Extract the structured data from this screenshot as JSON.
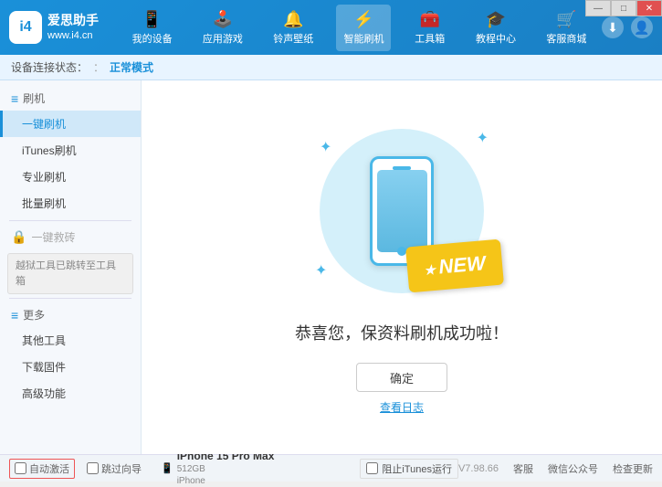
{
  "app": {
    "logo_code": "i4",
    "logo_url": "www.i4.cn",
    "brand_name": "爱思助手"
  },
  "nav": {
    "items": [
      {
        "id": "my-device",
        "label": "我的设备",
        "icon": "📱"
      },
      {
        "id": "apps-games",
        "label": "应用游戏",
        "icon": "🕹️"
      },
      {
        "id": "ringtones",
        "label": "铃声壁纸",
        "icon": "🔔"
      },
      {
        "id": "smart-flash",
        "label": "智能刷机",
        "icon": "⚡"
      },
      {
        "id": "toolbox",
        "label": "工具箱",
        "icon": "🧰"
      },
      {
        "id": "tutorial",
        "label": "教程中心",
        "icon": "🎓"
      },
      {
        "id": "services",
        "label": "客服商城",
        "icon": "🛒"
      }
    ]
  },
  "subheader": {
    "prefix": "设备连接状态：",
    "status": "正常模式"
  },
  "sidebar": {
    "sections": [
      {
        "id": "flash",
        "header": "刷机",
        "items": [
          {
            "id": "one-key-flash",
            "label": "一键刷机",
            "active": true
          },
          {
            "id": "itunes-flash",
            "label": "iTunes刷机"
          },
          {
            "id": "pro-flash",
            "label": "专业刷机"
          },
          {
            "id": "batch-flash",
            "label": "批量刷机"
          }
        ]
      },
      {
        "id": "one-key-rescue",
        "header": "一键救砖",
        "disabled": true,
        "notice": "越狱工具已跳转至工具箱"
      },
      {
        "id": "more",
        "header": "更多",
        "items": [
          {
            "id": "other-tools",
            "label": "其他工具"
          },
          {
            "id": "download-firmware",
            "label": "下载固件"
          },
          {
            "id": "advanced",
            "label": "高级功能"
          }
        ]
      }
    ]
  },
  "content": {
    "success_text": "恭喜您，保资料刷机成功啦！",
    "confirm_btn": "确定",
    "view_log": "查看日志",
    "new_badge": "NEW"
  },
  "footer": {
    "auto_activate_label": "自动激活",
    "guide_label": "跳过向导",
    "block_itunes_label": "阻止iTunes运行",
    "device": {
      "name": "iPhone 15 Pro Max",
      "storage": "512GB",
      "type": "iPhone"
    },
    "version": "V7.98.66",
    "links": [
      "客服",
      "微信公众号",
      "检查更新"
    ]
  },
  "window_controls": {
    "minimize": "—",
    "maximize": "□",
    "close": "✕"
  }
}
